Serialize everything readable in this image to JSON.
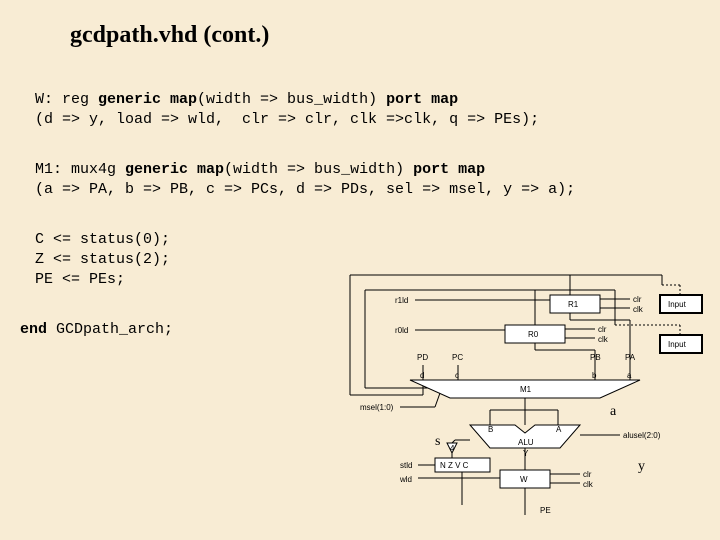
{
  "title": "gcdpath.vhd (cont.)",
  "code": {
    "l1a": "W: reg ",
    "l1b": "generic map",
    "l1c": "(width => bus_width) ",
    "l1d": "port map",
    "l2": "(d => y, load => wld,  clr => clr, clk =>clk, q => PEs);",
    "l3a": "M1: mux4g ",
    "l3b": "generic map",
    "l3c": "(width => bus_width) ",
    "l3d": "port map",
    "l4": "(a => PA, b => PB, c => PCs, d => PDs, sel => msel, y => a);",
    "l5": "C <= status(0);",
    "l6": "Z <= status(2);",
    "l7": "PE <= PEs;",
    "l8a": "end",
    "l8b": " GCDpath_arch;"
  },
  "diagram": {
    "r1": "R1",
    "r0": "R0",
    "m1": "M1",
    "alu": "ALU",
    "w": "W",
    "input1": "Input",
    "input2": "Input",
    "r1ld": "r1ld",
    "r0ld": "r0ld",
    "clr1": "clr",
    "clk1": "clk",
    "clr2": "clr",
    "clk2": "clk",
    "clr3": "clr",
    "clk3": "clk",
    "pd": "PD",
    "pc": "PC",
    "pb": "PB",
    "pa": "PA",
    "va": "a",
    "vs": "s",
    "vy": "y",
    "msel": "msel(1:0)",
    "md": "d",
    "mc": "c",
    "mb": "b",
    "ma": "a",
    "aluB": "B",
    "aluA": "A",
    "aluY": "Y",
    "alusel": "alusel(2:0)",
    "nzvc": "N Z V C",
    "stld": "stld",
    "wld": "wld",
    "tri": "4",
    "pe": "PE"
  }
}
